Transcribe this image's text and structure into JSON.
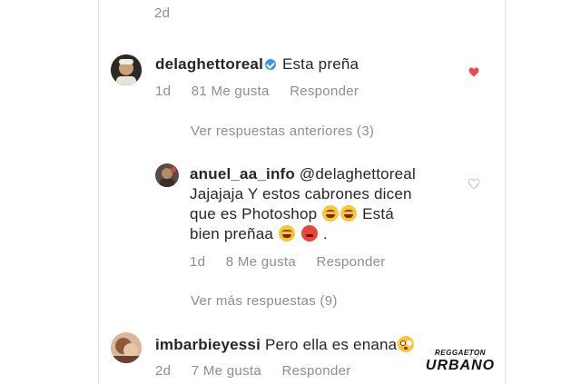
{
  "top_meta": {
    "time": "2d"
  },
  "comments": [
    {
      "username": "delaghettoreal",
      "verified": true,
      "text": "Esta preña",
      "time": "1d",
      "likes": "81 Me gusta",
      "reply": "Responder",
      "liked": true
    },
    {
      "username": "anuel_aa_info",
      "mention": "@delaghettoreal",
      "line1": "Jajajaja Y estos cabrones dicen",
      "line2": "que es Photoshop",
      "line2_tail": "Está",
      "line3": "bien preñaa",
      "line3_tail": ".",
      "time": "1d",
      "likes": "8 Me gusta",
      "reply": "Responder",
      "liked": false
    },
    {
      "username": "imbarbieyessi",
      "text": "Pero ella es enana",
      "time": "2d",
      "likes": "7 Me gusta",
      "reply": "Responder",
      "liked": false
    }
  ],
  "view_previous": "Ver respuestas anteriores (3)",
  "view_more": "Ver más respuestas (9)",
  "watermark": {
    "top": "REGGAETON",
    "main": "URBANO"
  },
  "colors": {
    "heart_liked": "#ed4956",
    "verified": "#3897f0",
    "meta_gray": "#8e8e8e"
  },
  "icons": {
    "heart_liked": "heart-filled-icon",
    "heart_empty": "heart-outline-icon",
    "verified": "verified-badge-icon",
    "emojis": [
      "rofl-emoji",
      "rofl-emoji",
      "joy-emoji",
      "red-face-emoji",
      "flushed-emoji"
    ]
  }
}
